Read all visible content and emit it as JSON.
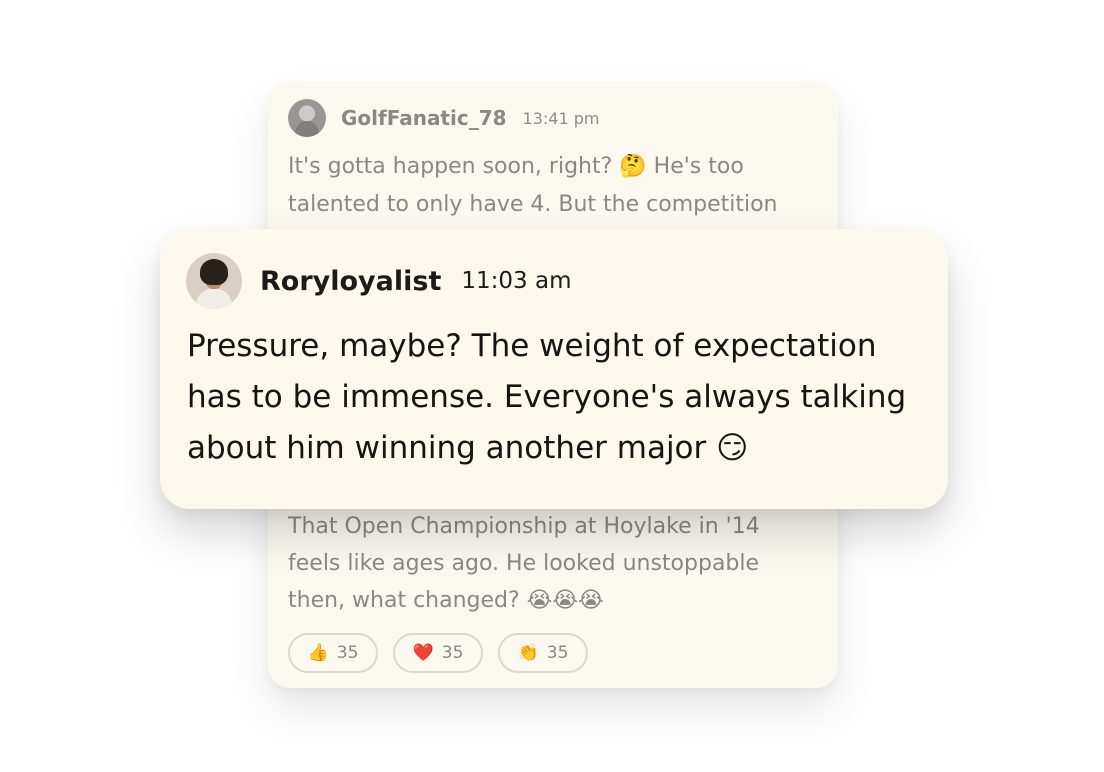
{
  "back_comment": {
    "username": "GolfFanatic_78",
    "time": "13:41 pm",
    "text_top": "It's gotta happen soon, right? 🤔 He's too talented to only have 4. But the competition",
    "text_bottom": "That Open Championship at Hoylake in '14 feels like ages ago. He looked unstoppable then, what changed? 😭😭😭",
    "reactions": [
      {
        "emoji": "👍",
        "count": "35",
        "icon": "thumbs-up-icon"
      },
      {
        "emoji": "❤️",
        "count": "35",
        "icon": "heart-icon"
      },
      {
        "emoji": "👏",
        "count": "35",
        "icon": "clap-icon"
      }
    ]
  },
  "featured_comment": {
    "username": "Roryloyalist",
    "time": "11:03 am",
    "text": "Pressure, maybe? The weight of expectation has to be immense. Everyone's always talking about him winning another major 😏"
  }
}
